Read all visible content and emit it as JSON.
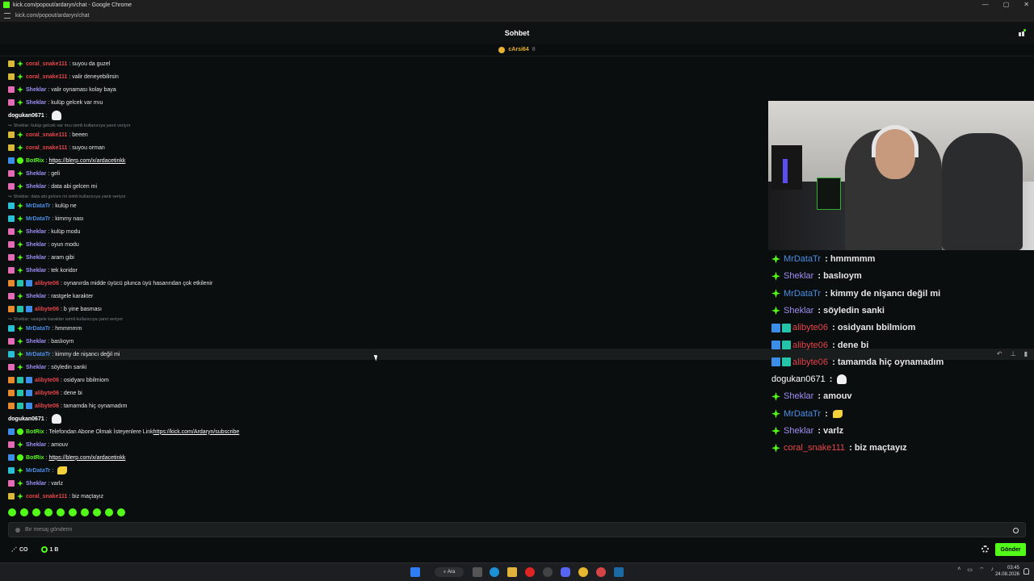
{
  "window": {
    "title": "kick.com/popout/ardaryn/chat - Google Chrome",
    "url": "kick.com/popout/ardaryn/chat"
  },
  "header": {
    "title": "Sohbet"
  },
  "pinned": {
    "name": "cArsi64",
    "count": "8"
  },
  "messages": [
    {
      "badges": [
        "yellow",
        "green"
      ],
      "user": "coral_snake111",
      "color": "coral",
      "text": "suyou da guzel"
    },
    {
      "badges": [
        "yellow",
        "green"
      ],
      "user": "coral_snake111",
      "color": "coral",
      "text": "valir deneyebilirsin"
    },
    {
      "badges": [
        "pink",
        "green"
      ],
      "user": "Sheklar",
      "color": "sheklar",
      "text": "valir oynaması kolay baya"
    },
    {
      "badges": [
        "pink",
        "green"
      ],
      "user": "Sheklar",
      "color": "sheklar",
      "text": "kulüp gelcek var mıu"
    },
    {
      "badges": [],
      "user": "dogukan0671",
      "color": "doguk",
      "text": "",
      "emote": "ghost"
    },
    {
      "reply": "Sheklar: kulüp gelcek var mıu isimli kullanıcıya yanıt veriyor"
    },
    {
      "badges": [
        "yellow",
        "green"
      ],
      "user": "coral_snake111",
      "color": "coral",
      "text": "beeen"
    },
    {
      "badges": [
        "yellow",
        "green"
      ],
      "user": "coral_snake111",
      "color": "coral",
      "text": "suyou orman"
    },
    {
      "badges": [
        "blue",
        "check"
      ],
      "user": "BotRix",
      "color": "botrix",
      "text": "",
      "link": "https://blerp.com/x/ardacetinkk"
    },
    {
      "badges": [
        "pink",
        "green"
      ],
      "user": "Sheklar",
      "color": "sheklar",
      "text": "geli"
    },
    {
      "badges": [
        "pink",
        "green"
      ],
      "user": "Sheklar",
      "color": "sheklar",
      "text": "data abi gelcen mi"
    },
    {
      "reply": "Sheklar: data abi gelcen mi isimli kullanıcıya yanıt veriyor"
    },
    {
      "badges": [
        "cyan",
        "green"
      ],
      "user": "MrDataTr",
      "color": "mrdata",
      "text": "kulüp ne"
    },
    {
      "badges": [
        "cyan",
        "green"
      ],
      "user": "MrDataTr",
      "color": "mrdata",
      "text": "kimmy nası"
    },
    {
      "badges": [
        "pink",
        "green"
      ],
      "user": "Sheklar",
      "color": "sheklar",
      "text": "kulüp modu"
    },
    {
      "badges": [
        "pink",
        "green"
      ],
      "user": "Sheklar",
      "color": "sheklar",
      "text": "oyun modu"
    },
    {
      "badges": [
        "pink",
        "green"
      ],
      "user": "Sheklar",
      "color": "sheklar",
      "text": "aram gibi"
    },
    {
      "badges": [
        "pink",
        "green"
      ],
      "user": "Sheklar",
      "color": "sheklar",
      "text": "tek koridor"
    },
    {
      "badges": [
        "orange",
        "teal",
        "blue"
      ],
      "user": "alibyte06",
      "color": "alibyte",
      "text": "oynanırda midde üyücü plunca üyü hasarından çok etkilenir"
    },
    {
      "badges": [
        "pink",
        "green"
      ],
      "user": "Sheklar",
      "color": "sheklar",
      "text": "rastgele karakter"
    },
    {
      "badges": [
        "orange",
        "teal",
        "blue"
      ],
      "user": "alibyte06",
      "color": "alibyte",
      "text": "b yine basması"
    },
    {
      "reply": "Sheklar: rastgele karakter isimli kullanıcıya yanıt veriyor"
    },
    {
      "badges": [
        "cyan",
        "green"
      ],
      "user": "MrDataTr",
      "color": "mrdata",
      "text": "hmmmmm"
    },
    {
      "badges": [
        "pink",
        "green"
      ],
      "user": "Sheklar",
      "color": "sheklar",
      "text": "baslıoym"
    },
    {
      "badges": [
        "cyan",
        "green"
      ],
      "user": "MrDataTr",
      "color": "mrdata",
      "text": "kimmy de nişancı değil mi",
      "highlight": true
    },
    {
      "badges": [
        "pink",
        "green"
      ],
      "user": "Sheklar",
      "color": "sheklar",
      "text": "söyledin sanki"
    },
    {
      "badges": [
        "orange",
        "teal",
        "blue"
      ],
      "user": "alibyte06",
      "color": "alibyte",
      "text": "osidyanı bbilmiom"
    },
    {
      "badges": [
        "orange",
        "teal",
        "blue"
      ],
      "user": "alibyte06",
      "color": "alibyte",
      "text": "dene bi"
    },
    {
      "badges": [
        "orange",
        "teal",
        "blue"
      ],
      "user": "alibyte06",
      "color": "alibyte",
      "text": "tamamda hiç oynamadım"
    },
    {
      "badges": [],
      "user": "dogukan0671",
      "color": "doguk",
      "text": "",
      "emote": "ghost"
    },
    {
      "badges": [
        "blue",
        "check"
      ],
      "user": "BotRix",
      "color": "botrix",
      "text": "Telefondan Abone Olmak İsteyenlere Link ",
      "link": "https://kick.com/Ardaryn/subscribe"
    },
    {
      "badges": [
        "pink",
        "green"
      ],
      "user": "Sheklar",
      "color": "sheklar",
      "text": "amouv"
    },
    {
      "badges": [
        "blue",
        "check"
      ],
      "user": "BotRix",
      "color": "botrix",
      "text": "",
      "link": "https://blerp.com/x/ardacetinkk"
    },
    {
      "badges": [
        "cyan",
        "green"
      ],
      "user": "MrDataTr",
      "color": "mrdata",
      "text": "",
      "emote": "banana"
    },
    {
      "badges": [
        "pink",
        "green"
      ],
      "user": "Sheklar",
      "color": "sheklar",
      "text": "varlz"
    },
    {
      "badges": [
        "yellow",
        "green"
      ],
      "user": "coral_snake111",
      "color": "coral",
      "text": "biz maçtayız"
    }
  ],
  "overlay": [
    {
      "badges": [
        "green"
      ],
      "user": "MrDataTr",
      "color": "mrdata",
      "text": "hmmmmm"
    },
    {
      "badges": [
        "green"
      ],
      "user": "Sheklar",
      "color": "sheklar",
      "text": "baslıoym"
    },
    {
      "badges": [
        "green"
      ],
      "user": "MrDataTr",
      "color": "mrdata",
      "text": "kimmy de nişancı değil mi"
    },
    {
      "badges": [
        "green"
      ],
      "user": "Sheklar",
      "color": "sheklar",
      "text": "söyledin sanki"
    },
    {
      "badges": [
        "blue",
        "teal"
      ],
      "user": "alibyte06",
      "color": "alibyte",
      "text": "osidyanı bbilmiom"
    },
    {
      "badges": [
        "blue",
        "teal"
      ],
      "user": "alibyte06",
      "color": "alibyte",
      "text": "dene bi"
    },
    {
      "badges": [
        "blue",
        "teal"
      ],
      "user": "alibyte06",
      "color": "alibyte",
      "text": "tamamda hiç oynamadım"
    },
    {
      "badges": [],
      "user": "dogukan0671",
      "color": "doguk",
      "text": "",
      "emote": "ghost"
    },
    {
      "badges": [
        "green"
      ],
      "user": "Sheklar",
      "color": "sheklar",
      "text": "amouv"
    },
    {
      "badges": [
        "green"
      ],
      "user": "MrDataTr",
      "color": "mrdata",
      "text": "",
      "emote": "banana"
    },
    {
      "badges": [
        "green"
      ],
      "user": "Sheklar",
      "color": "sheklar",
      "text": "varlz"
    },
    {
      "badges": [
        "green"
      ],
      "user": "coral_snake111",
      "color": "coral",
      "text": "biz maçtayız"
    }
  ],
  "input": {
    "placeholder": "Bir mesaj gönderin"
  },
  "footer": {
    "left_stat": "CO",
    "viewers": "1 B",
    "send_label": "Gönder"
  },
  "taskbar": {
    "search_label": "Ara",
    "time": "03:45",
    "date": "24.08.2026"
  },
  "colors": {
    "kick_green": "#53fc18",
    "background": "#0b0e0f",
    "coral": "#e8454a",
    "sheklar": "#9d8ff5",
    "mrdata": "#4a8fe6"
  }
}
